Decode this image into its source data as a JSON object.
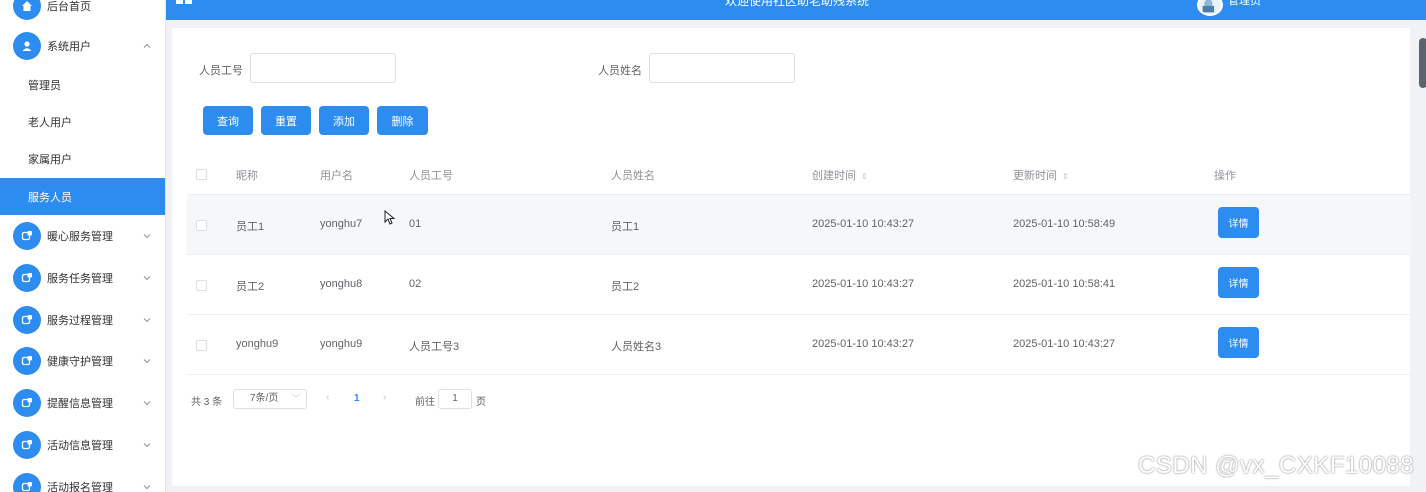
{
  "header": {
    "title": "欢迎使用社区助老助残系统",
    "user": "管理员"
  },
  "sidebar": {
    "home": "后台首页",
    "system_users": "系统用户",
    "sub_items": [
      "管理员",
      "老人用户",
      "家属用户",
      "服务人员"
    ],
    "items": [
      "暖心服务管理",
      "服务任务管理",
      "服务过程管理",
      "健康守护管理",
      "提醒信息管理",
      "活动信息管理",
      "活动报名管理"
    ]
  },
  "search": {
    "id_label": "人员工号",
    "id_value": "",
    "name_label": "人员姓名",
    "name_value": ""
  },
  "buttons": {
    "query": "查询",
    "reset": "重置",
    "add": "添加",
    "delete": "删除"
  },
  "table": {
    "headers": [
      "昵称",
      "用户名",
      "人员工号",
      "人员姓名",
      "创建时间",
      "更新时间",
      "操作"
    ],
    "detail_label": "详情",
    "rows": [
      {
        "nickname": "员工1",
        "username": "yonghu7",
        "staff_id": "01",
        "staff_name": "员工1",
        "created": "2025-01-10 10:43:27",
        "updated": "2025-01-10 10:58:49"
      },
      {
        "nickname": "员工2",
        "username": "yonghu8",
        "staff_id": "02",
        "staff_name": "员工2",
        "created": "2025-01-10 10:43:27",
        "updated": "2025-01-10 10:58:41"
      },
      {
        "nickname": "yonghu9",
        "username": "yonghu9",
        "staff_id": "人员工号3",
        "staff_name": "人员姓名3",
        "created": "2025-01-10 10:43:27",
        "updated": "2025-01-10 10:43:27"
      }
    ]
  },
  "pagination": {
    "total": "共 3 条",
    "page_size": "7条/页",
    "current_page": "1",
    "goto_label": "前往",
    "goto_value": "1",
    "unit": "页"
  },
  "watermark": "CSDN @vx_CXKF10088",
  "colors": {
    "primary": "#2d8cf0",
    "background": "#f0f2f5"
  }
}
